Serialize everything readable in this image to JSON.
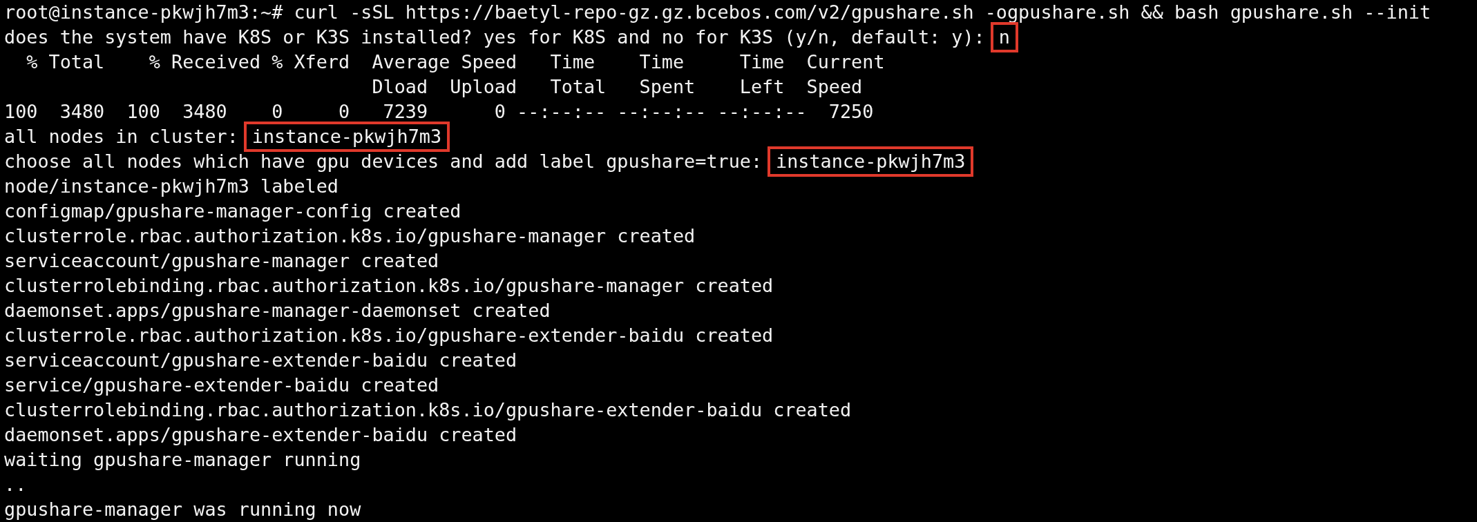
{
  "terminal": {
    "lines": [
      {
        "text": "root@instance-pkwjh7m3:~# curl -sSL https://baetyl-repo-gz.gz.bcebos.com/v2/gpushare.sh -ogpushare.sh && bash gpushare.sh --init"
      },
      {
        "text": "does the system have K8S or K3S installed? yes for K8S and no for K3S (y/n, default: y):",
        "answer": "n"
      },
      {
        "text": "  % Total    % Received % Xferd  Average Speed   Time    Time     Time  Current"
      },
      {
        "text": "                                 Dload  Upload   Total   Spent    Left  Speed"
      },
      {
        "text": "100  3480  100  3480    0     0   7239      0 --:--:-- --:--:-- --:--:--  7250"
      },
      {
        "text": "all nodes in cluster:",
        "answer": "instance-pkwjh7m3"
      },
      {
        "text": "choose all nodes which have gpu devices and add label gpushare=true:",
        "answer": "instance-pkwjh7m3"
      },
      {
        "text": "node/instance-pkwjh7m3 labeled"
      },
      {
        "text": "configmap/gpushare-manager-config created"
      },
      {
        "text": "clusterrole.rbac.authorization.k8s.io/gpushare-manager created"
      },
      {
        "text": "serviceaccount/gpushare-manager created"
      },
      {
        "text": "clusterrolebinding.rbac.authorization.k8s.io/gpushare-manager created"
      },
      {
        "text": "daemonset.apps/gpushare-manager-daemonset created"
      },
      {
        "text": "clusterrole.rbac.authorization.k8s.io/gpushare-extender-baidu created"
      },
      {
        "text": "serviceaccount/gpushare-extender-baidu created"
      },
      {
        "text": "service/gpushare-extender-baidu created"
      },
      {
        "text": "clusterrolebinding.rbac.authorization.k8s.io/gpushare-extender-baidu created"
      },
      {
        "text": "daemonset.apps/gpushare-extender-baidu created"
      },
      {
        "text": "waiting gpushare-manager running"
      },
      {
        "text": ".."
      },
      {
        "text": "gpushare-manager was running now"
      }
    ]
  }
}
